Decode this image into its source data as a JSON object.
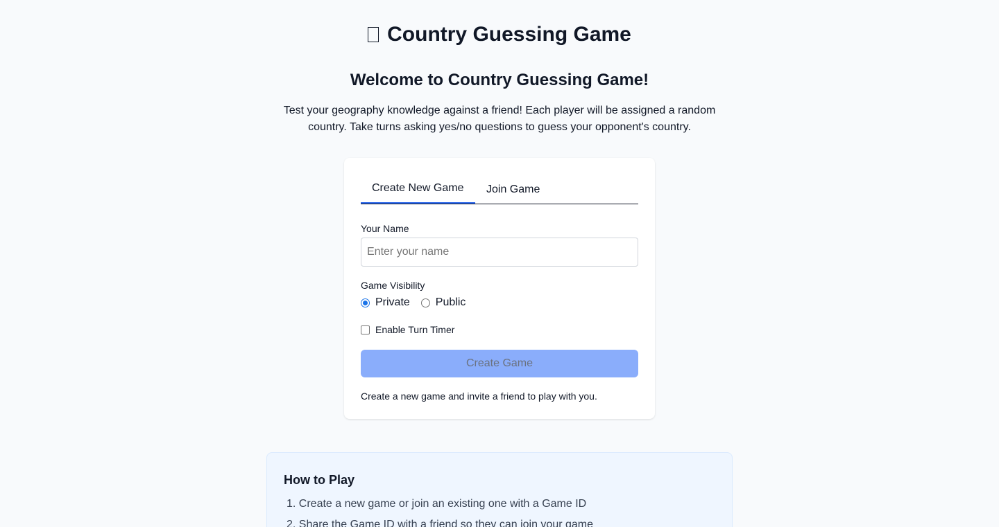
{
  "header": {
    "title": "Country Guessing Game",
    "icon": "globe-icon"
  },
  "welcome": {
    "heading": "Welcome to Country Guessing Game!",
    "intro": "Test your geography knowledge against a friend! Each player will be assigned a random country. Take turns asking yes/no questions to guess your opponent's country."
  },
  "card": {
    "tabs": [
      {
        "label": "Create New Game",
        "active": true
      },
      {
        "label": "Join Game",
        "active": false
      }
    ],
    "name_label": "Your Name",
    "name_placeholder": "Enter your name",
    "name_value": "",
    "visibility_label": "Game Visibility",
    "visibility_options": [
      {
        "label": "Private",
        "checked": true
      },
      {
        "label": "Public",
        "checked": false
      }
    ],
    "timer_label": "Enable Turn Timer",
    "timer_checked": false,
    "create_button": "Create Game",
    "create_button_disabled": true,
    "helper_text": "Create a new game and invite a friend to play with you."
  },
  "how_to_play": {
    "title": "How to Play",
    "steps": [
      "1. Create a new game or join an existing one with a Game ID",
      "2. Share the Game ID with a friend so they can join your game"
    ]
  },
  "colors": {
    "background": "#f8fafc",
    "accent": "#2563eb",
    "button_disabled": "#8aadfb",
    "howto_bg": "#eff6ff"
  }
}
